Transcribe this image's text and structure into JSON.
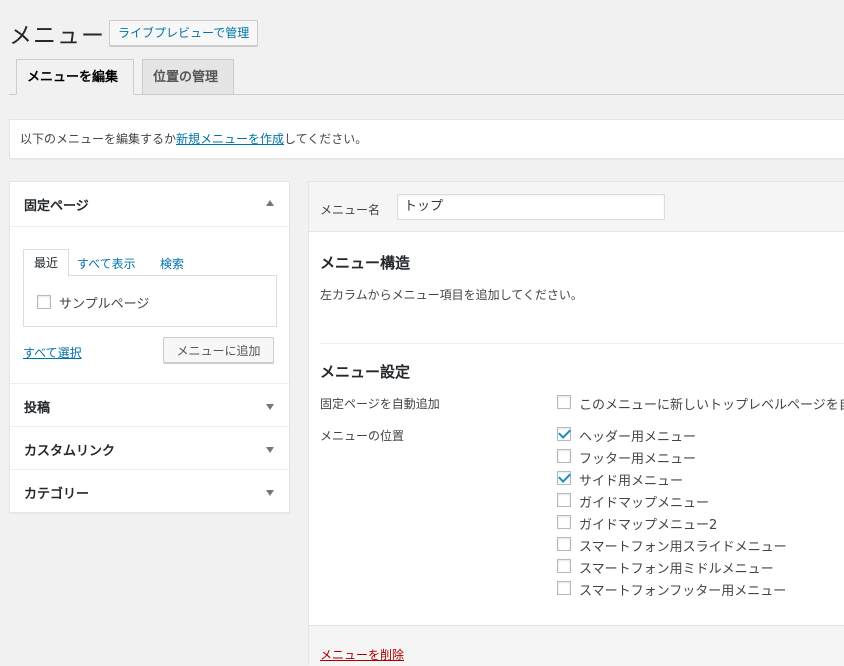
{
  "header": {
    "title": "メニュー",
    "live_preview_button": "ライブプレビューで管理"
  },
  "tabs": [
    {
      "label": "メニューを編集",
      "active": true
    },
    {
      "label": "位置の管理",
      "active": false
    }
  ],
  "notice": {
    "prefix": "以下のメニューを編集するか",
    "link": "新規メニューを作成",
    "suffix": "してください。"
  },
  "sidebar": {
    "pages_section": {
      "title": "固定ページ",
      "tabs": [
        "最近",
        "すべて表示",
        "検索"
      ],
      "items": [
        {
          "label": "サンプルページ",
          "checked": false
        }
      ],
      "select_all": "すべて選択",
      "add_button": "メニューに追加"
    },
    "sections": [
      {
        "title": "投稿"
      },
      {
        "title": "カスタムリンク"
      },
      {
        "title": "カテゴリー"
      }
    ]
  },
  "menu": {
    "name_label": "メニュー名",
    "name_value": "トップ",
    "structure_title": "メニュー構造",
    "structure_text": "左カラムからメニュー項目を追加してください。",
    "settings_title": "メニュー設定",
    "auto_add_label": "固定ページを自動追加",
    "auto_add_option": {
      "label": "このメニューに新しいトップレベルページを自",
      "checked": false
    },
    "location_label": "メニューの位置",
    "locations": [
      {
        "label": "ヘッダー用メニュー",
        "checked": true
      },
      {
        "label": "フッター用メニュー",
        "checked": false
      },
      {
        "label": "サイド用メニュー",
        "checked": true
      },
      {
        "label": "ガイドマップメニュー",
        "checked": false
      },
      {
        "label": "ガイドマップメニュー2",
        "checked": false
      },
      {
        "label": "スマートフォン用スライドメニュー",
        "checked": false
      },
      {
        "label": "スマートフォン用ミドルメニュー",
        "checked": false
      },
      {
        "label": "スマートフォンフッター用メニュー",
        "checked": false
      }
    ],
    "delete_link": "メニューを削除"
  },
  "colors": {
    "link": "#0073aa",
    "delete": "#aa0000",
    "check": "#1e8cbe"
  }
}
